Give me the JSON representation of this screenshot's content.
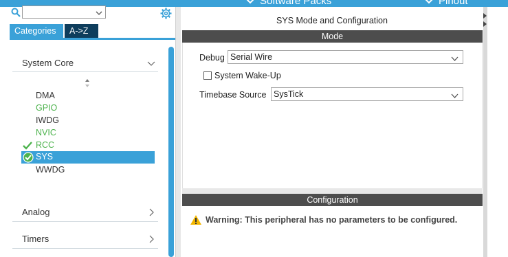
{
  "topbar": {
    "software_packs_label": "Software Packs",
    "pinout_label": "Pinout"
  },
  "sidebar": {
    "search": {
      "value": "",
      "placeholder": ""
    },
    "tabs": [
      {
        "label": "Categories",
        "active": true
      },
      {
        "label": "A->Z",
        "active": false
      }
    ],
    "sections": [
      {
        "label": "System Core",
        "expanded": true,
        "items": [
          {
            "label": "DMA",
            "status": "none"
          },
          {
            "label": "GPIO",
            "status": "green"
          },
          {
            "label": "IWDG",
            "status": "none"
          },
          {
            "label": "NVIC",
            "status": "green"
          },
          {
            "label": "RCC",
            "status": "configured"
          },
          {
            "label": "SYS",
            "status": "selected"
          },
          {
            "label": "WWDG",
            "status": "none"
          }
        ]
      },
      {
        "label": "Analog",
        "expanded": false
      },
      {
        "label": "Timers",
        "expanded": false
      }
    ]
  },
  "main": {
    "title": "SYS Mode and Configuration",
    "mode_header": "Mode",
    "debug": {
      "label": "Debug",
      "value": "Serial Wire"
    },
    "wakeup": {
      "label": "System Wake-Up",
      "checked": false
    },
    "timebase": {
      "label": "Timebase Source",
      "value": "SysTick"
    },
    "config_header": "Configuration",
    "warning": "Warning: This peripheral has no parameters to be configured."
  },
  "colors": {
    "accent": "#3aa1d8",
    "dark_tab": "#0e3d5c",
    "header_bar": "#4d4d4d",
    "green": "#4db34d",
    "warning": "#f2b600"
  }
}
